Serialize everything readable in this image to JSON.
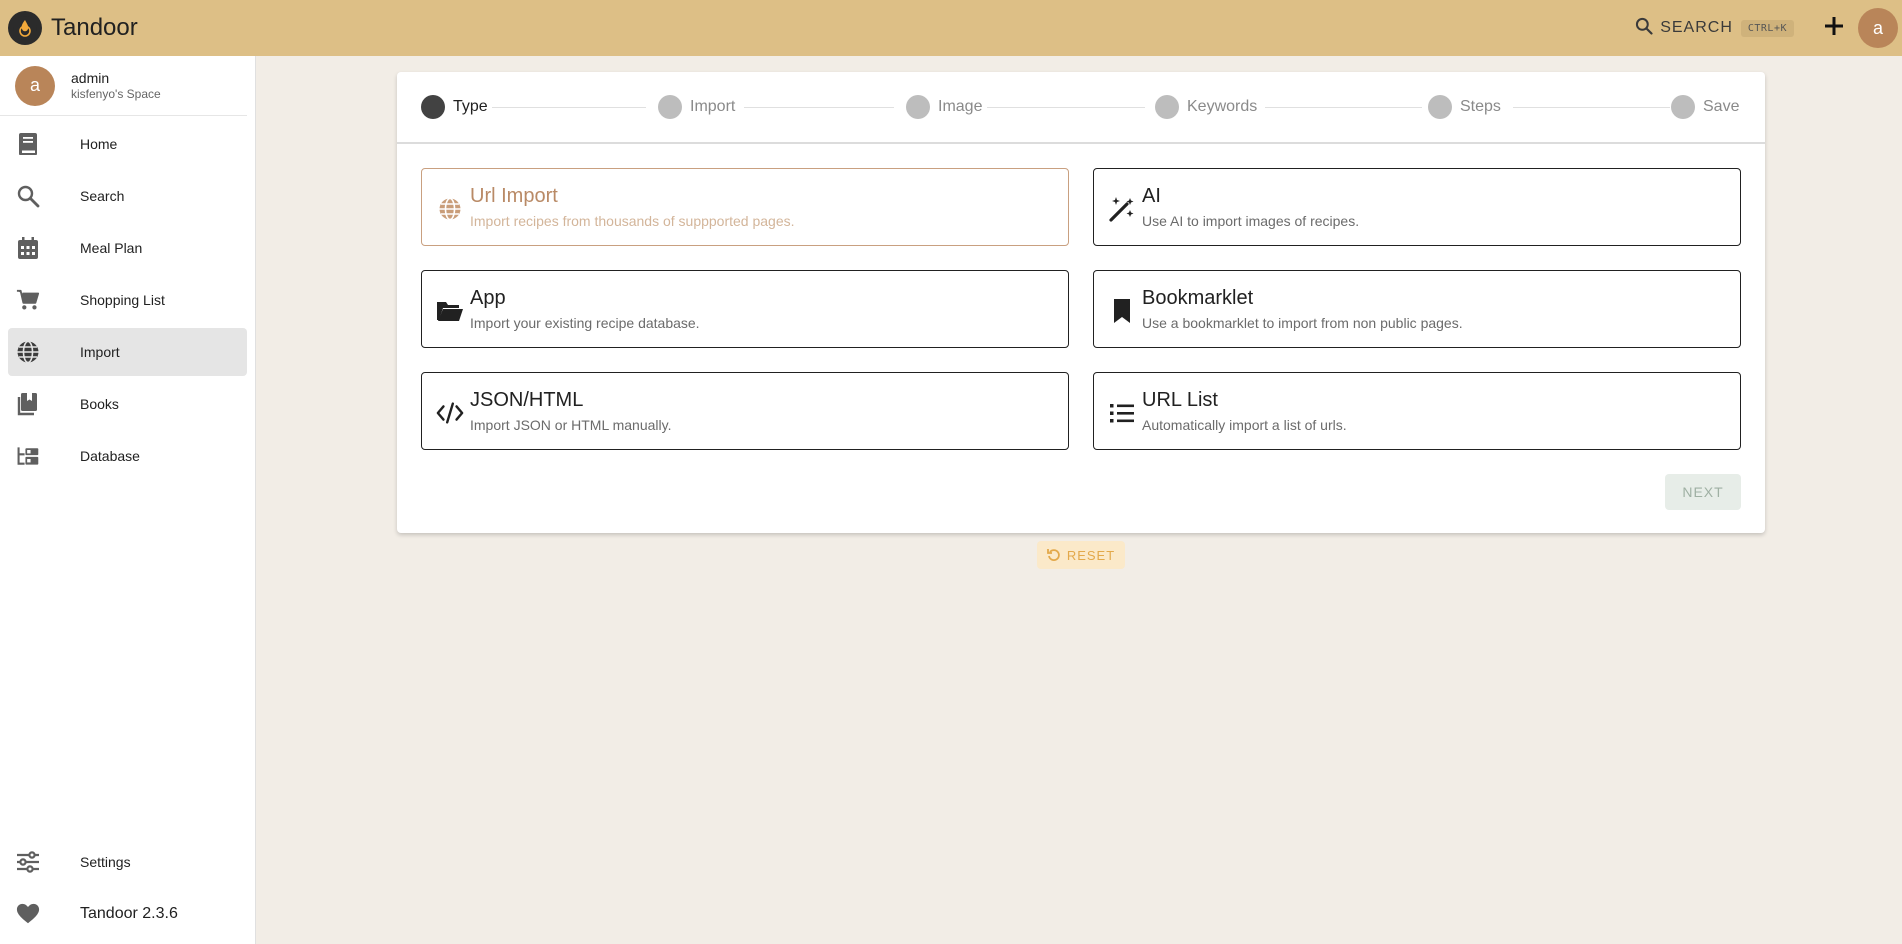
{
  "app": {
    "title": "Tandoor"
  },
  "topbar": {
    "search_label": "SEARCH",
    "search_shortcut": "CTRL+K",
    "avatar_initial": "a",
    "icons": [
      "logo-icon",
      "search-icon",
      "plus-icon"
    ]
  },
  "sidebar": {
    "user": {
      "initial": "a",
      "name": "admin",
      "space": "kisfenyo's Space"
    },
    "items": [
      {
        "label": "Home",
        "icon": "book-icon"
      },
      {
        "label": "Search",
        "icon": "search-icon"
      },
      {
        "label": "Meal Plan",
        "icon": "calendar-icon"
      },
      {
        "label": "Shopping List",
        "icon": "cart-icon"
      },
      {
        "label": "Import",
        "icon": "globe-icon",
        "active": true
      },
      {
        "label": "Books",
        "icon": "bookshelf-icon"
      },
      {
        "label": "Database",
        "icon": "database-tree-icon"
      }
    ],
    "bottom": [
      {
        "label": "Settings",
        "icon": "sliders-icon"
      },
      {
        "label": "Tandoor 2.3.6",
        "icon": "heart-icon"
      }
    ]
  },
  "stepper": {
    "steps": [
      {
        "label": "Type",
        "active": true
      },
      {
        "label": "Import"
      },
      {
        "label": "Image"
      },
      {
        "label": "Keywords"
      },
      {
        "label": "Steps"
      },
      {
        "label": "Save"
      }
    ]
  },
  "options": [
    {
      "title": "Url Import",
      "desc": "Import recipes from thousands of suppported pages.",
      "icon": "globe-icon",
      "selected": true
    },
    {
      "title": "AI",
      "desc": "Use AI to import images of recipes.",
      "icon": "magic-wand-icon"
    },
    {
      "title": "App",
      "desc": "Import your existing recipe database.",
      "icon": "folder-open-icon"
    },
    {
      "title": "Bookmarklet",
      "desc": "Use a bookmarklet to import from non public pages.",
      "icon": "bookmark-icon"
    },
    {
      "title": "JSON/HTML",
      "desc": "Import JSON or HTML manually.",
      "icon": "code-icon"
    },
    {
      "title": "URL List",
      "desc": "Automatically import a list of urls.",
      "icon": "list-icon"
    }
  ],
  "actions": {
    "next_label": "NEXT",
    "reset_label": "RESET"
  },
  "colors": {
    "topbar": "#ddbf86",
    "avatar": "#b98559",
    "background": "#f2ede6",
    "selected_border": "#c9a080",
    "reset_text": "#e3a94b"
  }
}
